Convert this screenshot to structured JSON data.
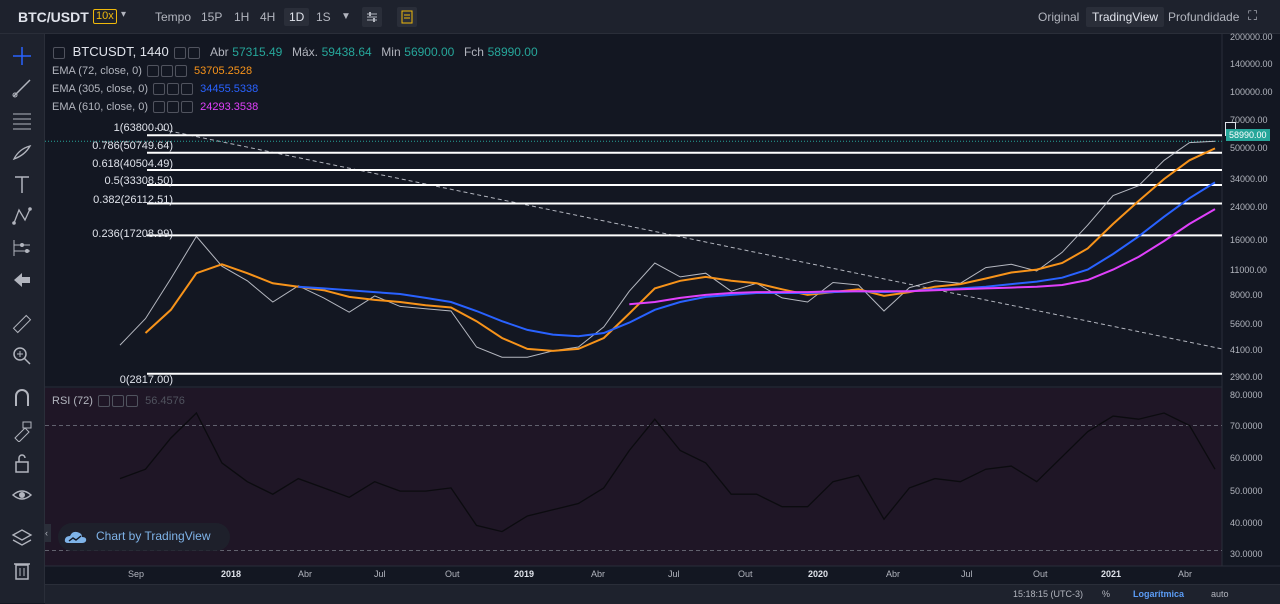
{
  "topbar": {
    "symbol": "BTC/USDT",
    "leverage": "10x",
    "tempo": "Tempo",
    "timeframes": [
      "15P",
      "1H",
      "4H",
      "1D",
      "1S"
    ],
    "active_timeframe": "1D",
    "views": [
      "Original",
      "TradingView",
      "Profundidade"
    ],
    "active_view": "TradingView"
  },
  "legend": {
    "title": "BTCUSDT, 1440",
    "open_label": "Abr",
    "open": "57315.49",
    "high_label": "Máx.",
    "high": "59438.64",
    "low_label": "Min",
    "low": "56900.00",
    "close_label": "Fch",
    "close": "58990.00"
  },
  "indicators": [
    {
      "label": "EMA (72, close, 0)",
      "value": "53705.2528",
      "color": "#f7931a"
    },
    {
      "label": "EMA (305, close, 0)",
      "value": "34455.5338",
      "color": "#2962ff"
    },
    {
      "label": "EMA (610, close, 0)",
      "value": "24293.3538",
      "color": "#e040fb"
    }
  ],
  "fib": [
    {
      "label": "1(63800.00)",
      "price": 63800
    },
    {
      "label": "0.786(50749.64)",
      "price": 50749.64
    },
    {
      "label": "0.618(40504.49)",
      "price": 40504.49
    },
    {
      "label": "0.5(33308.50)",
      "price": 33308.5
    },
    {
      "label": "0.382(26112.51)",
      "price": 26112.51
    },
    {
      "label": "0.236(17208.99)",
      "price": 17208.99
    },
    {
      "label": "0(2817.00)",
      "price": 2817
    }
  ],
  "price_axis": [
    "200000.00",
    "140000.00",
    "100000.00",
    "70000.00",
    "50000.00",
    "34000.00",
    "24000.00",
    "16000.00",
    "11000.00",
    "8000.00",
    "5600.00",
    "4100.00",
    "2900.00"
  ],
  "last_price": "58990.00",
  "rsi": {
    "label": "RSI (72)",
    "value": "56.4576",
    "axis": [
      "80.0000",
      "70.0000",
      "60.0000",
      "50.0000",
      "40.0000",
      "30.0000"
    ]
  },
  "time_axis": [
    {
      "label": "Sep",
      "bold": false
    },
    {
      "label": "2018",
      "bold": true
    },
    {
      "label": "Abr",
      "bold": false
    },
    {
      "label": "Jul",
      "bold": false
    },
    {
      "label": "Out",
      "bold": false
    },
    {
      "label": "2019",
      "bold": true
    },
    {
      "label": "Abr",
      "bold": false
    },
    {
      "label": "Jul",
      "bold": false
    },
    {
      "label": "Out",
      "bold": false
    },
    {
      "label": "2020",
      "bold": true
    },
    {
      "label": "Abr",
      "bold": false
    },
    {
      "label": "Jul",
      "bold": false
    },
    {
      "label": "Out",
      "bold": false
    },
    {
      "label": "2021",
      "bold": true
    },
    {
      "label": "Abr",
      "bold": false
    }
  ],
  "watermark": "Chart by TradingView",
  "bottombar": {
    "time": "15:18:15 (UTC-3)",
    "percent": "%",
    "log": "Logarítmica",
    "auto": "auto"
  },
  "chart_data": {
    "type": "line",
    "price_scale": "log",
    "ylim": [
      2400,
      240000
    ],
    "x": [
      "2017-09",
      "2017-10",
      "2017-11",
      "2017-12",
      "2018-01",
      "2018-02",
      "2018-03",
      "2018-04",
      "2018-05",
      "2018-06",
      "2018-07",
      "2018-08",
      "2018-09",
      "2018-10",
      "2018-11",
      "2018-12",
      "2019-01",
      "2019-02",
      "2019-03",
      "2019-04",
      "2019-05",
      "2019-06",
      "2019-07",
      "2019-08",
      "2019-09",
      "2019-10",
      "2019-11",
      "2019-12",
      "2020-01",
      "2020-02",
      "2020-03",
      "2020-04",
      "2020-05",
      "2020-06",
      "2020-07",
      "2020-08",
      "2020-09",
      "2020-10",
      "2020-11",
      "2020-12",
      "2021-01",
      "2021-02",
      "2021-03",
      "2021-04"
    ],
    "series": [
      {
        "name": "BTCUSDT, 1440",
        "values": [
          4100,
          5800,
          9800,
          17000,
          11500,
          9500,
          7200,
          8900,
          7600,
          6300,
          7800,
          6800,
          6600,
          6400,
          4000,
          3500,
          3500,
          3800,
          4000,
          5200,
          8300,
          12000,
          10000,
          10500,
          8300,
          9200,
          7600,
          7200,
          9300,
          9000,
          6400,
          8700,
          9500,
          9200,
          11300,
          11800,
          10800,
          13800,
          19700,
          29000,
          33000,
          46000,
          58000,
          58990
        ]
      },
      {
        "name": "EMA (72, close, 0)",
        "values": [
          null,
          4800,
          6500,
          10500,
          11800,
          10500,
          9200,
          8800,
          8400,
          7700,
          7400,
          7200,
          6900,
          6700,
          5600,
          4500,
          3900,
          3800,
          3900,
          4500,
          6200,
          8600,
          9500,
          10000,
          9500,
          9200,
          8500,
          7900,
          8200,
          8500,
          7800,
          8200,
          8800,
          9100,
          9800,
          10600,
          11000,
          12000,
          14500,
          20000,
          27000,
          36000,
          46000,
          53705
        ]
      },
      {
        "name": "EMA (305, close, 0)",
        "values": [
          null,
          null,
          null,
          null,
          null,
          null,
          null,
          8800,
          8600,
          8400,
          8200,
          8000,
          7600,
          7200,
          6400,
          5600,
          5000,
          4700,
          4600,
          4800,
          5500,
          6500,
          7200,
          7700,
          7900,
          8100,
          8100,
          8100,
          8200,
          8300,
          8200,
          8300,
          8500,
          8600,
          8800,
          9100,
          9400,
          9900,
          11000,
          13500,
          17000,
          22000,
          28000,
          34455
        ]
      },
      {
        "name": "EMA (610, close, 0)",
        "values": [
          null,
          null,
          null,
          null,
          null,
          null,
          null,
          null,
          null,
          null,
          null,
          null,
          null,
          null,
          null,
          null,
          null,
          null,
          null,
          null,
          7000,
          7200,
          7600,
          7900,
          8100,
          8200,
          8200,
          8200,
          8300,
          8300,
          8300,
          8300,
          8400,
          8500,
          8600,
          8700,
          8800,
          9000,
          9600,
          11000,
          13000,
          16000,
          20000,
          24293
        ]
      }
    ],
    "rsi_values": [
      53,
      56,
      66,
      74,
      58,
      52,
      48,
      53,
      50,
      47,
      52,
      49,
      49,
      50,
      38,
      36,
      41,
      43,
      45,
      50,
      62,
      72,
      62,
      58,
      48,
      48,
      44,
      44,
      52,
      54,
      40,
      50,
      53,
      52,
      56,
      57,
      52,
      60,
      68,
      73,
      72,
      74,
      70,
      56
    ]
  }
}
